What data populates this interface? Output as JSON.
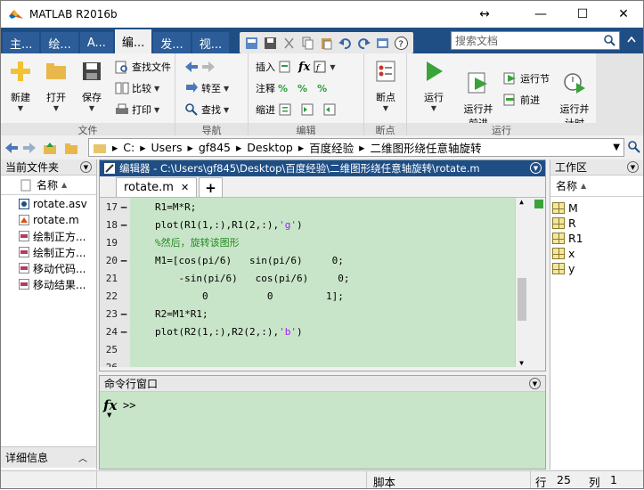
{
  "window": {
    "title": "MATLAB R2016b"
  },
  "tabs": [
    {
      "label": "主..."
    },
    {
      "label": "绘..."
    },
    {
      "label": "A..."
    },
    {
      "label": "编..."
    },
    {
      "label": "发..."
    },
    {
      "label": "视..."
    }
  ],
  "search": {
    "placeholder": "搜索文档"
  },
  "ribbon": {
    "file_group": {
      "label": "文件",
      "new": "新建",
      "open": "打开",
      "save": "保存",
      "find_files": "查找文件",
      "compare": "比较",
      "print": "打印"
    },
    "nav_group": {
      "label": "导航",
      "goto": "转至",
      "find": "查找"
    },
    "edit_group": {
      "label": "编辑",
      "insert": "插入",
      "comment": "注释",
      "indent": "缩进",
      "fx": "fx"
    },
    "breakpoints_group": {
      "label": "断点",
      "breakpoints": "断点"
    },
    "run_group": {
      "label": "运行",
      "run": "运行",
      "run_advance": "运行并\n前进",
      "run_section": "运行节",
      "advance": "前进",
      "run_time": "运行并\n计时"
    }
  },
  "address": {
    "path": [
      "C:",
      "Users",
      "gf845",
      "Desktop",
      "百度经验",
      "二维图形绕任意轴旋转"
    ]
  },
  "current_folder": {
    "header": "当前文件夹",
    "column": "名称",
    "files": [
      {
        "name": "rotate.asv",
        "icon": "asv-file-icon"
      },
      {
        "name": "rotate.m",
        "icon": "m-file-icon"
      },
      {
        "name": "绘制正方...",
        "icon": "png-file-icon"
      },
      {
        "name": "绘制正方...",
        "icon": "png-file-icon"
      },
      {
        "name": "移动代码...",
        "icon": "png-file-icon"
      },
      {
        "name": "移动结果...",
        "icon": "png-file-icon"
      }
    ],
    "details": "详细信息"
  },
  "editor": {
    "header": "编辑器 - C:\\Users\\gf845\\Desktop\\百度经验\\二维图形绕任意轴旋转\\rotate.m",
    "tab": "rotate.m",
    "lines": [
      {
        "n": "17",
        "dash": "–",
        "text": "R1=M*R;",
        "kind": "code"
      },
      {
        "n": "18",
        "dash": "–",
        "text": "plot(R1(1,:),R1(2,:),",
        "str": "'g'",
        "tail": ")",
        "kind": "str"
      },
      {
        "n": "19",
        "dash": "",
        "text": "%然后，旋转该图形",
        "kind": "cmt"
      },
      {
        "n": "20",
        "dash": "–",
        "text": "M1=[cos(pi/6)   sin(pi/6)     0;",
        "kind": "code"
      },
      {
        "n": "21",
        "dash": "",
        "text": "    -sin(pi/6)   cos(pi/6)     0;",
        "kind": "code"
      },
      {
        "n": "22",
        "dash": "",
        "text": "        0          0         1];",
        "kind": "code"
      },
      {
        "n": "23",
        "dash": "–",
        "text": "R2=M1*R1;",
        "kind": "code"
      },
      {
        "n": "24",
        "dash": "–",
        "text": "plot(R2(1,:),R2(2,:),",
        "str": "'b'",
        "tail": ")",
        "kind": "str"
      },
      {
        "n": "25",
        "dash": "",
        "text": "",
        "kind": "code"
      },
      {
        "n": "26",
        "dash": "",
        "text": "",
        "kind": "code"
      }
    ]
  },
  "command_window": {
    "header": "命令行窗口",
    "prompt": ">>",
    "fx": "fx"
  },
  "workspace": {
    "header": "工作区",
    "column": "名称",
    "vars": [
      "M",
      "R",
      "R1",
      "x",
      "y"
    ]
  },
  "status": {
    "script": "脚本",
    "row_label": "行",
    "row": "25",
    "col_label": "列",
    "col": "1"
  },
  "colors": {
    "title_blue": "#1f4e85",
    "code_bg": "#c9e5c9",
    "string": "#a020f0",
    "comment": "#228b22"
  }
}
